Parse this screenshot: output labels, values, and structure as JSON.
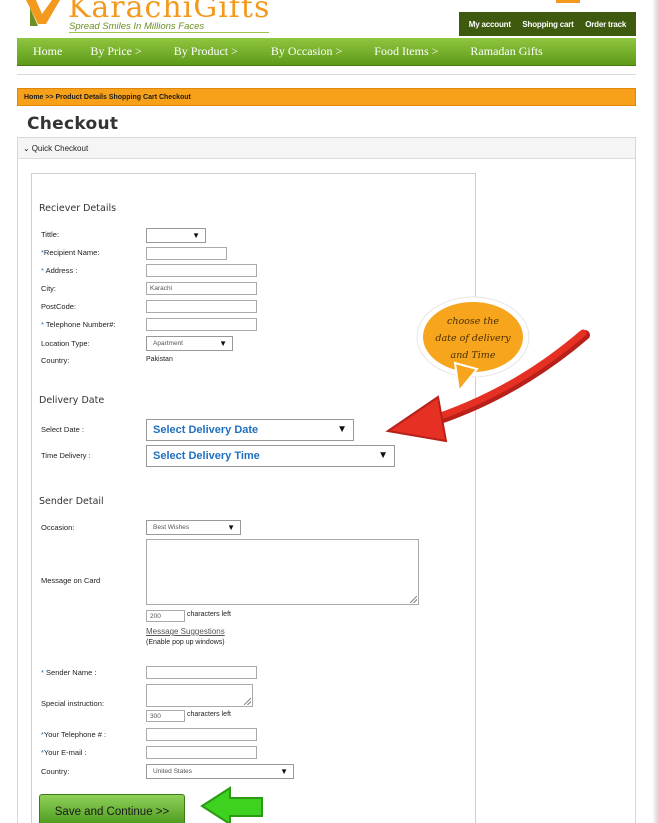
{
  "brand": {
    "name": "KarachiGifts",
    "tagline": "Spread Smiles In Millions Faces",
    "accent": "#f39a1e",
    "green": "#5e9a1a"
  },
  "account_links": [
    "My account",
    "Shopping cart",
    "Order track"
  ],
  "nav": [
    "Home",
    "By Price >",
    "By Product >",
    "By Occasion >",
    "Food Items >",
    "Ramadan Gifts"
  ],
  "breadcrumb": "Home >> Product Details Shopping Cart  Checkout",
  "page_title": "Checkout",
  "panel_title": "Quick Checkout",
  "receiver": {
    "title": "Reciever Details",
    "labels": {
      "title_label": "Tittle:",
      "name": "Recipient Name:",
      "address": "Address :",
      "city": "City:",
      "postcode": "PostCode:",
      "phone": "Telephone Number#:",
      "location": "Location Type:",
      "country": "Country:"
    },
    "city_value": "Karachi",
    "location_value": "Apartment",
    "country_value": "Pakistan"
  },
  "delivery": {
    "title": "Delivery Date",
    "date_label": "Select Date :",
    "date_value": "Select Delivery Date",
    "time_label": "Time Delivery :",
    "time_value": "Select Delivery Time"
  },
  "sender": {
    "title": "Sender Detail",
    "occasion_label": "Occasion:",
    "occasion_value": "Best Wishes",
    "message_label": "Message on Card",
    "message_chars": "200",
    "chars_left": "characters left",
    "suggestions_link": "Message Suggestions",
    "popup_note": "(Enable pop up windows)",
    "sender_name_label": "Sender Name :",
    "special_label": "Special instruction:",
    "special_chars": "300",
    "phone_label": "Your Telephone # :",
    "email_label": "Your E-mail :",
    "country_label": "Country:",
    "country_value": "United States"
  },
  "save_button": "Save and Continue >>",
  "annotation": {
    "line1": "choose the",
    "line2": "date of delivery",
    "line3": "and Time",
    "arrow_color": "#e53023",
    "bubble_color": "#f6a51d"
  }
}
